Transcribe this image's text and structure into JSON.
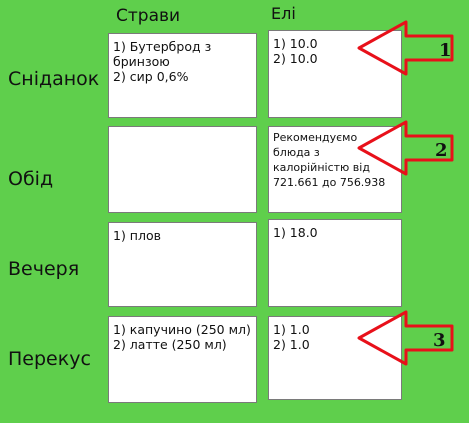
{
  "headers": {
    "dishes": "Страви",
    "eaten": "Елі"
  },
  "meals": [
    {
      "label": "Сніданок",
      "dishes": [
        "1) Бутерброд з бринзою",
        "2) сир 0,6%"
      ],
      "eaten": [
        "1) 10.0",
        "2) 10.0"
      ]
    },
    {
      "label": "Обід",
      "dishes": [],
      "eaten": [
        "Рекомендуємо блюда з калорійністю від 721.661 до 756.938"
      ]
    },
    {
      "label": "Вечеря",
      "dishes": [
        "1) плов"
      ],
      "eaten": [
        "1) 18.0"
      ]
    },
    {
      "label": "Перекус",
      "dishes": [
        "1) капучино (250 мл)",
        "2) латте (250 мл)"
      ],
      "eaten": [
        "1) 1.0",
        "2) 1.0"
      ]
    }
  ],
  "annotations": [
    "1",
    "2",
    "3"
  ],
  "colors": {
    "background": "#5fcf4c",
    "arrow": "#e8101a"
  }
}
